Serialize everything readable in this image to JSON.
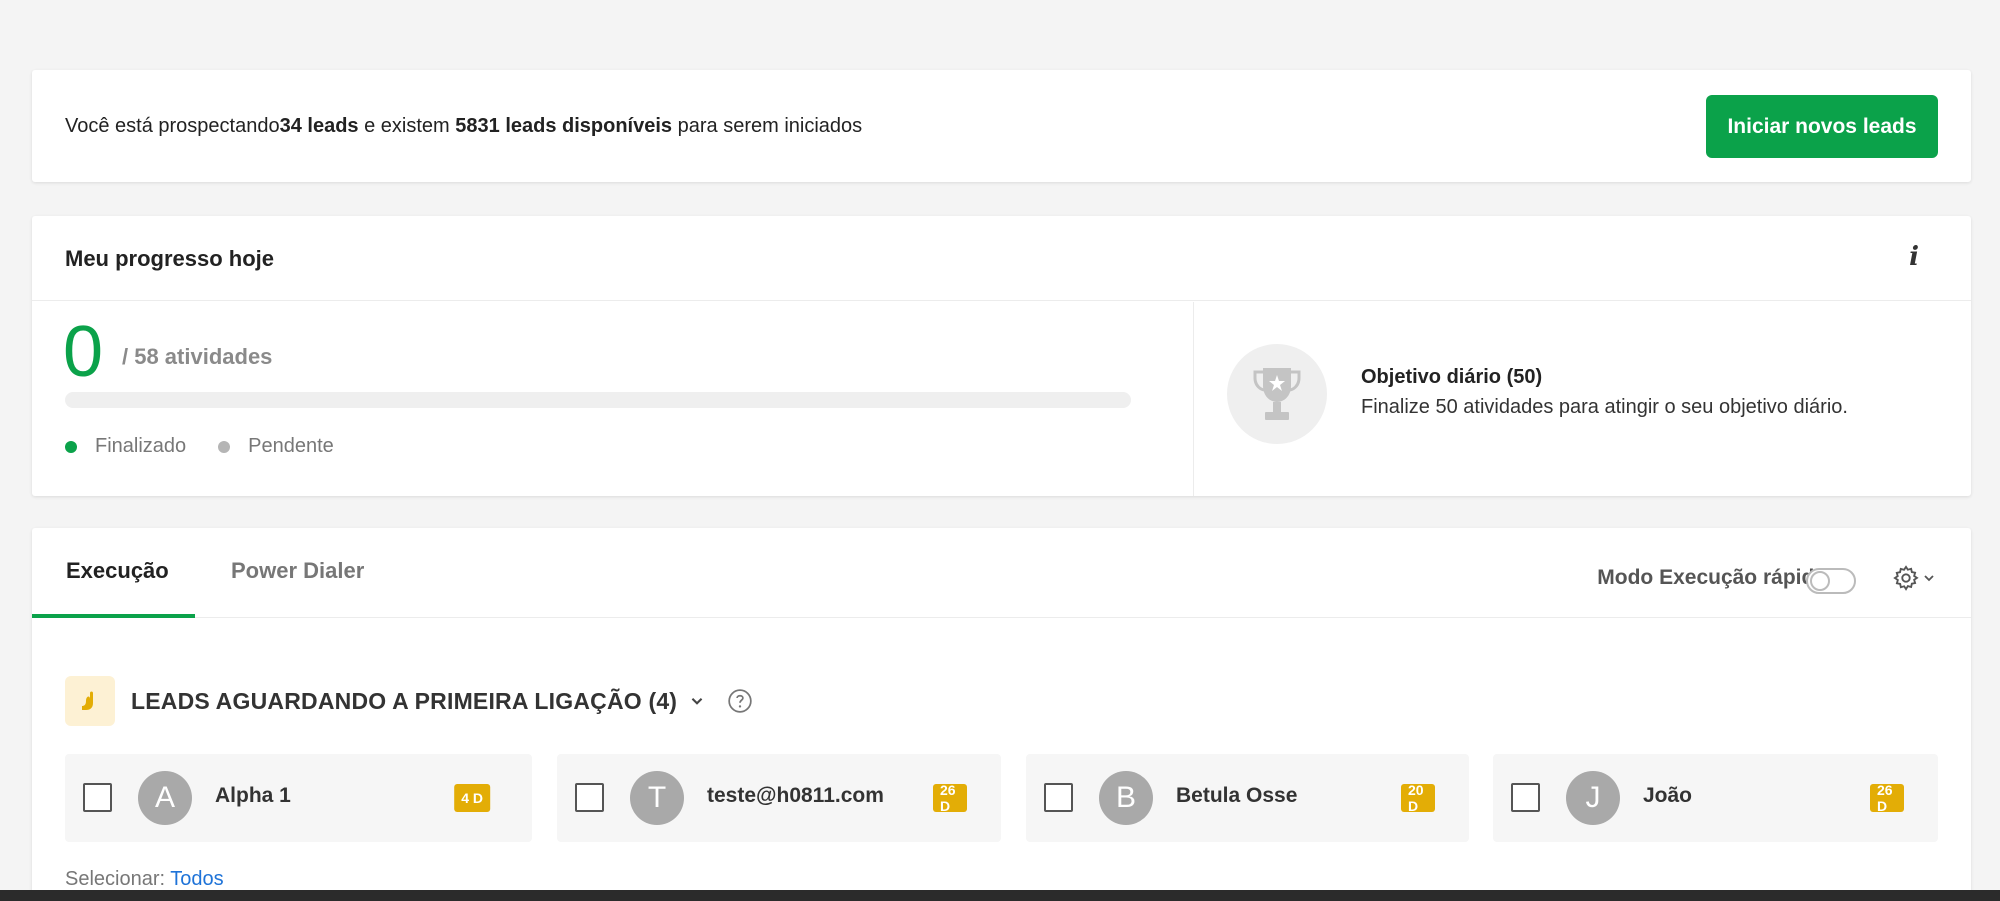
{
  "banner": {
    "text_pre": "Você está prospectando ",
    "leads_count": "34 leads",
    "text_mid": " e existem ",
    "available": "5831 leads disponíveis",
    "text_post": " para serem iniciados",
    "button_label": "Iniciar novos leads"
  },
  "progress": {
    "title": "Meu progresso hoje",
    "info_glyph": "i",
    "done": "0",
    "total_label": "/ 58 atividades",
    "fraction_done": 0,
    "legend_done": "Finalizado",
    "legend_pending": "Pendente",
    "goal_title": "Objetivo diário (50)",
    "goal_desc": "Finalize 50 atividades para atingir o seu objetivo diário."
  },
  "execution": {
    "tabs": [
      {
        "label": "Execução",
        "active": true
      },
      {
        "label": "Power Dialer",
        "active": false
      }
    ],
    "quick_mode_label": "Modo Execução rápida",
    "quick_mode_on": false,
    "section_title": "LEADS AGUARDANDO A PRIMEIRA LIGAÇÃO (4)",
    "leads": [
      {
        "initial": "A",
        "name": "Alpha 1",
        "badge": "4 D"
      },
      {
        "initial": "T",
        "name": "teste@h0811.com",
        "badge": "26 D"
      },
      {
        "initial": "B",
        "name": "Betula Osse",
        "badge": "20 D"
      },
      {
        "initial": "J",
        "name": "João",
        "badge": "26 D"
      }
    ],
    "select_label": "Selecionar: ",
    "select_all": "Todos"
  },
  "colors": {
    "accent": "#0ba24a",
    "badge": "#e3ad06",
    "link": "#1e73d8"
  }
}
